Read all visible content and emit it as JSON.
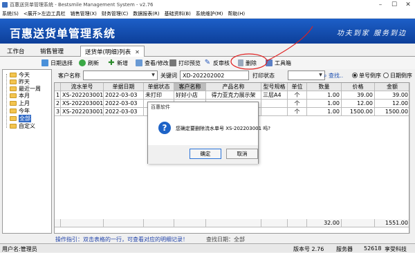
{
  "window": {
    "title": "百惠送货单管理系统 - Bestsmile Management System - v2.76"
  },
  "menu": [
    "系统(S)",
    "<展开>左边工具栏",
    "销售管理(X)",
    "财务管理(C)",
    "数据报表(R)",
    "基础资料(B)",
    "系统维护(M)",
    "帮助(H)"
  ],
  "banner": {
    "logo": "百惠送货单管理系统",
    "slogan": "功夫到家  服务到边"
  },
  "tabs": [
    {
      "label": "工作台"
    },
    {
      "label": "销售管理"
    },
    {
      "label": "送货单(明细)列表",
      "close": "✕"
    }
  ],
  "toolbar": {
    "date_select": "日期选择",
    "refresh": "刷新",
    "add": "新增",
    "view_edit": "查看/修改",
    "print_preview": "打印预览",
    "reverse_audit": "反审核",
    "delete": "删除",
    "toolbox": "工具箱"
  },
  "tree": {
    "items": [
      "今天",
      "昨天",
      "最近一周",
      "本月",
      "上月",
      "今年",
      "全部",
      "自定义"
    ],
    "selected": "全部"
  },
  "search": {
    "customer_label": "客户名称",
    "customer_value": "",
    "keyword_label": "关键词",
    "keyword_value": "XD-202202002",
    "print_status_label": "打印状态",
    "print_status_value": "",
    "search_button": "查找..",
    "sort_number": "单号倒序",
    "sort_date": "日期倒序"
  },
  "table": {
    "headers": [
      "",
      "流水单号",
      "单据日期",
      "单据状态",
      "客户名称",
      "产品名称",
      "型号规格",
      "单位",
      "数量",
      "价格",
      "金额"
    ],
    "rows": [
      [
        "1",
        "XS-202203001",
        "2022-03-03",
        "未打印",
        "好好小店",
        "得力亚克力展示架",
        "三层A4",
        "个",
        "1.00",
        "39.00",
        "39.00"
      ],
      [
        "2",
        "XS-202203001",
        "2022-03-03",
        "",
        "",
        "",
        "",
        "个",
        "1.00",
        "12.00",
        "12.00"
      ],
      [
        "3",
        "XS-202203001",
        "2022-03-03",
        "",
        "",
        "",
        "",
        "个",
        "1.00",
        "1500.00",
        "1500.00"
      ]
    ],
    "footer": {
      "qty": "32.00",
      "amount": "1551.00"
    }
  },
  "hint": {
    "text": "操作指引：双击表格的一行，可查看对应的明细记录！",
    "date": "查找日期：全部"
  },
  "statusbar": {
    "user": "用户名:管理员",
    "version": "版本号 2.76",
    "service": "服务器",
    "port": "52618",
    "extra": "享受科技"
  },
  "dialog": {
    "title": "百惠软件",
    "message": "您确定要删除流水单号 XS-202203001 吗?",
    "ok": "确定",
    "cancel": "取消"
  },
  "colors": {
    "banner": "#1d5fc8",
    "annotation": "#e02020",
    "selection": "#316ac5"
  }
}
